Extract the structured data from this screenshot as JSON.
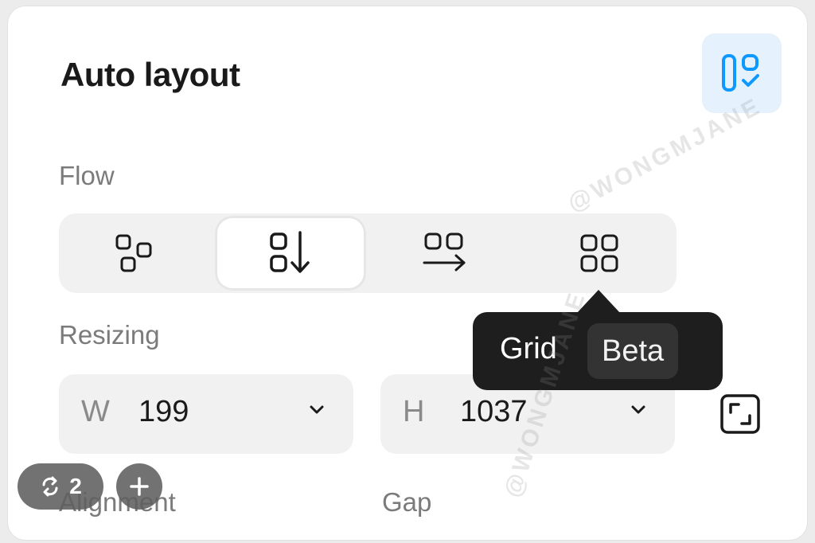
{
  "panel": {
    "title": "Auto layout",
    "suggest_icon": "auto-layout-suggestion-icon"
  },
  "flow": {
    "label": "Flow",
    "options": [
      {
        "icon": "freeform-layout-icon",
        "selected": false
      },
      {
        "icon": "vertical-layout-icon",
        "selected": true
      },
      {
        "icon": "horizontal-layout-icon",
        "selected": false
      },
      {
        "icon": "grid-layout-icon",
        "selected": false
      }
    ]
  },
  "tooltip": {
    "text": "Grid",
    "badge": "Beta"
  },
  "resizing": {
    "label": "Resizing",
    "width": {
      "axis": "W",
      "value": "199"
    },
    "height": {
      "axis": "H",
      "value": "1037"
    },
    "clip_icon": "resize-corners-icon"
  },
  "bottom": {
    "alignment_label": "Alignment",
    "gap_label": "Gap"
  },
  "overlay": {
    "count": "2",
    "count_icon": "repeat-icon",
    "add_icon": "plus-icon"
  },
  "watermark": "@WONGMJANE",
  "colors": {
    "accent": "#0d99ff",
    "accent_bg": "#e5f2fd",
    "tooltip_bg": "#1e1e1e"
  }
}
